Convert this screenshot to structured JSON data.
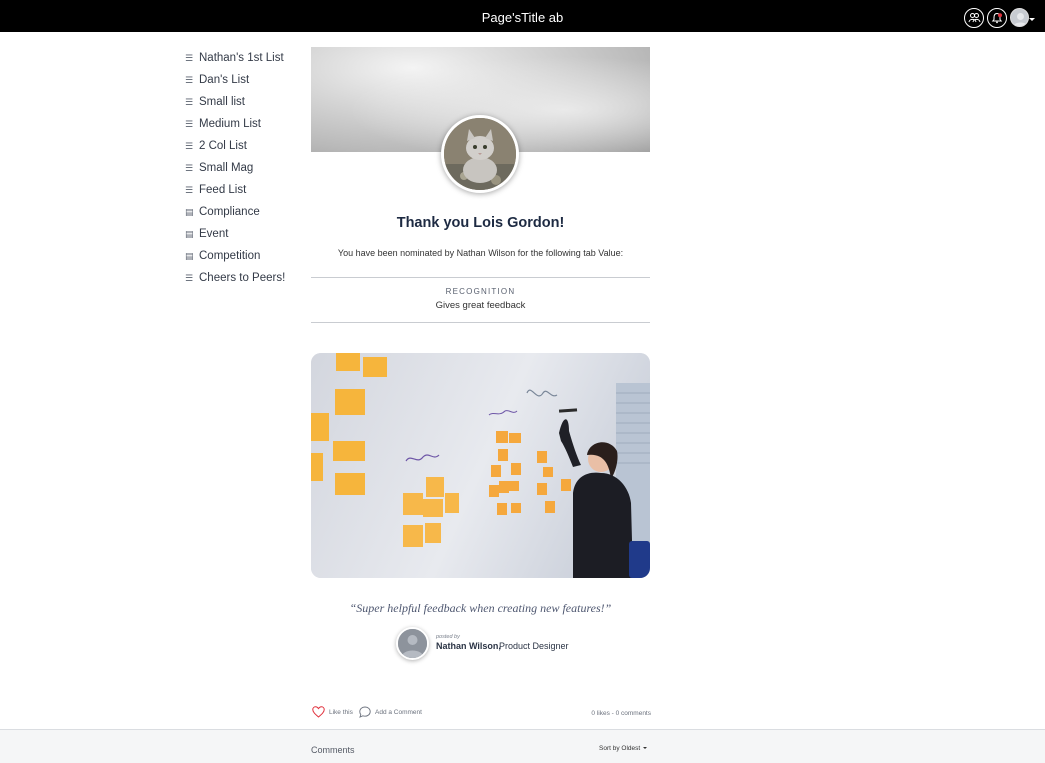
{
  "header": {
    "title": "Page'sTitle ab"
  },
  "sidebar": {
    "items": [
      {
        "label": "Nathan's 1st List",
        "icon": "list-icon"
      },
      {
        "label": "Dan's List",
        "icon": "list-icon"
      },
      {
        "label": "Small list",
        "icon": "list-icon"
      },
      {
        "label": "Medium List",
        "icon": "list-icon"
      },
      {
        "label": "2 Col List",
        "icon": "list-icon"
      },
      {
        "label": "Small Mag",
        "icon": "list-icon"
      },
      {
        "label": "Feed List",
        "icon": "list-icon"
      },
      {
        "label": "Compliance",
        "icon": "document-icon"
      },
      {
        "label": "Event",
        "icon": "document-icon"
      },
      {
        "label": "Competition",
        "icon": "document-icon"
      },
      {
        "label": "Cheers to Peers!",
        "icon": "list-icon"
      }
    ]
  },
  "post": {
    "heading": "Thank you Lois Gordon!",
    "nominated_text": "You have been nominated by Nathan Wilson for the following tab Value:",
    "recognition_label": "RECOGNITION",
    "recognition_value": "Gives great feedback",
    "quote": "“Super helpful feedback when creating new features!”",
    "posted_by_label": "posted by",
    "author_name": "Nathan Wilson,",
    "author_role": "Product Designer"
  },
  "actions": {
    "like_label": "Like this",
    "comment_label": "Add a Comment",
    "counts": "0 likes - 0 comments"
  },
  "comments": {
    "title": "Comments",
    "sort_label": "Sort by Oldest"
  },
  "colors": {
    "topbar": "#000000",
    "heading": "#1d2a42",
    "like_heart": "#e0303c"
  }
}
